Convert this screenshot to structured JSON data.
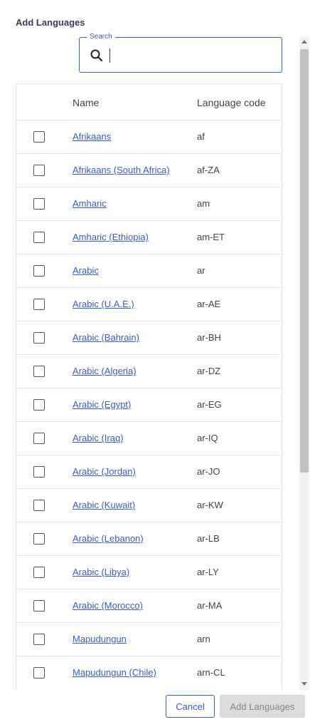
{
  "dialog": {
    "title": "Add Languages"
  },
  "search": {
    "legend": "Search",
    "value": "",
    "placeholder": ""
  },
  "table": {
    "headers": {
      "name": "Name",
      "code": "Language code"
    },
    "rows": [
      {
        "name": "Afrikaans",
        "code": "af"
      },
      {
        "name": "Afrikaans (South Africa)",
        "code": "af-ZA"
      },
      {
        "name": "Amharic",
        "code": "am"
      },
      {
        "name": "Amharic (Ethiopia)",
        "code": "am-ET"
      },
      {
        "name": "Arabic",
        "code": "ar"
      },
      {
        "name": "Arabic (U.A.E.)",
        "code": "ar-AE"
      },
      {
        "name": "Arabic (Bahrain)",
        "code": "ar-BH"
      },
      {
        "name": "Arabic (Algeria)",
        "code": "ar-DZ"
      },
      {
        "name": "Arabic (Egypt)",
        "code": "ar-EG"
      },
      {
        "name": "Arabic (Iraq)",
        "code": "ar-IQ"
      },
      {
        "name": "Arabic (Jordan)",
        "code": "ar-JO"
      },
      {
        "name": "Arabic (Kuwait)",
        "code": "ar-KW"
      },
      {
        "name": "Arabic (Lebanon)",
        "code": "ar-LB"
      },
      {
        "name": "Arabic (Libya)",
        "code": "ar-LY"
      },
      {
        "name": "Arabic (Morocco)",
        "code": "ar-MA"
      },
      {
        "name": "Mapudungun",
        "code": "arn"
      },
      {
        "name": "Mapudungun (Chile)",
        "code": "arn-CL"
      },
      {
        "name": "",
        "code": ""
      }
    ]
  },
  "footer": {
    "cancel_label": "Cancel",
    "add_label": "Add Languages"
  },
  "colors": {
    "accent": "#3a5bc7",
    "link": "#3a5bc7",
    "disabled_bg": "#dcdcdc"
  },
  "icons": {
    "search": "search-icon",
    "checkbox": "checkbox-unchecked"
  }
}
